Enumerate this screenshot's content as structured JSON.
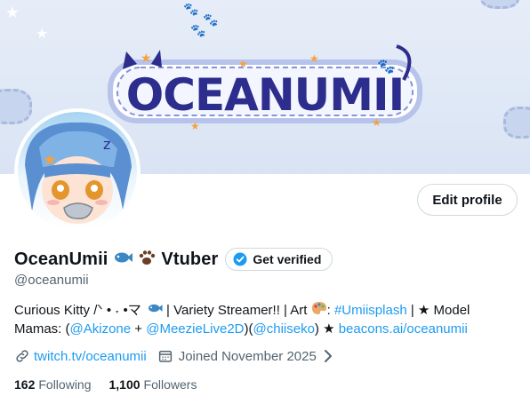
{
  "banner": {
    "logo_text": "OCEANUMII"
  },
  "profile": {
    "display_name": "OceanUmii",
    "display_name_suffix": "Vtuber",
    "verified_label": "Get verified",
    "handle": "@oceanumii",
    "edit_profile_label": "Edit profile"
  },
  "bio": {
    "line1_a": "Curious Kitty /ᐠ • ˕ •マ",
    "line1_b": " | Variety Streamer!! | Art ",
    "line1_c": ": ",
    "hashtag": "#Umiisplash",
    "line1_d": " | ★ Model",
    "line2_a": "Mamas: (",
    "mention1": "@Akizone",
    "line2_b": " + ",
    "mention2": "@MeezieLive2D",
    "line2_c": ")(",
    "mention3": "@chiiseko",
    "line2_d": ") ★ ",
    "beacons": "beacons.ai/oceanumii"
  },
  "meta": {
    "website": "twitch.tv/oceanumii",
    "joined": "Joined November 2025"
  },
  "stats": {
    "following_count": "162",
    "following_label": "Following",
    "followers_count": "1,100",
    "followers_label": "Followers"
  },
  "colors": {
    "accent": "#1d9bf0",
    "muted": "#536471",
    "text": "#0f1419"
  },
  "icons": [
    "link-icon",
    "calendar-icon",
    "chevron-right-icon",
    "verified-badge-icon",
    "fish-emoji-icon",
    "paw-emoji-icon",
    "palette-emoji-icon"
  ]
}
